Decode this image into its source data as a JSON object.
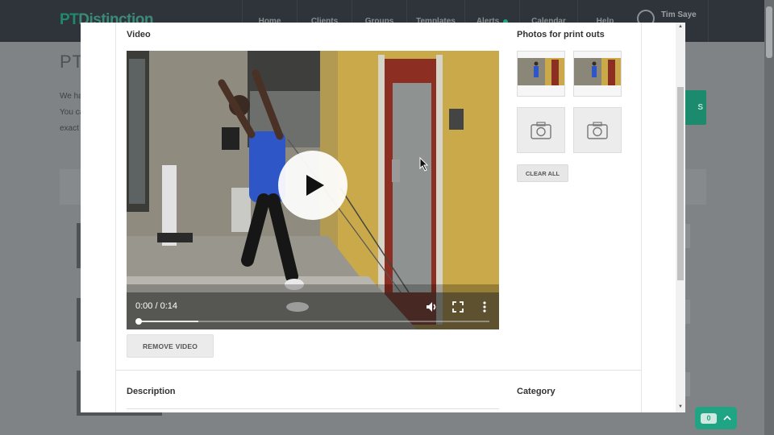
{
  "app": {
    "logo_pt": "PT",
    "logo_rest": "Distinction",
    "nav": [
      "Home",
      "Clients",
      "Groups",
      "Templates",
      "Alerts",
      "Calendar",
      "Help"
    ],
    "user_name": "Tim Saye",
    "page_title": "PT",
    "intro_lines": [
      "We ha",
      "You ca",
      "exact"
    ],
    "side_button_label": "S",
    "chat_count": "0"
  },
  "modal": {
    "video_heading": "Video",
    "video_time": "0:00 / 0:14",
    "video_progress_fraction": 0.0,
    "video_buffered_fraction": 0.17,
    "remove_video_label": "REMOVE VIDEO",
    "photos_heading": "Photos for print outs",
    "photo_slots": [
      "filled",
      "filled",
      "empty",
      "empty"
    ],
    "clear_all_label": "CLEAR ALL",
    "description_heading": "Description",
    "category_heading": "Category"
  },
  "icons": {
    "play": "play-icon",
    "volume": "volume-icon",
    "fullscreen": "fullscreen-icon",
    "more": "more-vert-icon",
    "camera": "camera-icon",
    "chat": "chat-icon"
  },
  "colors": {
    "brand_green": "#1fa584",
    "header_dark": "#2e3439"
  }
}
